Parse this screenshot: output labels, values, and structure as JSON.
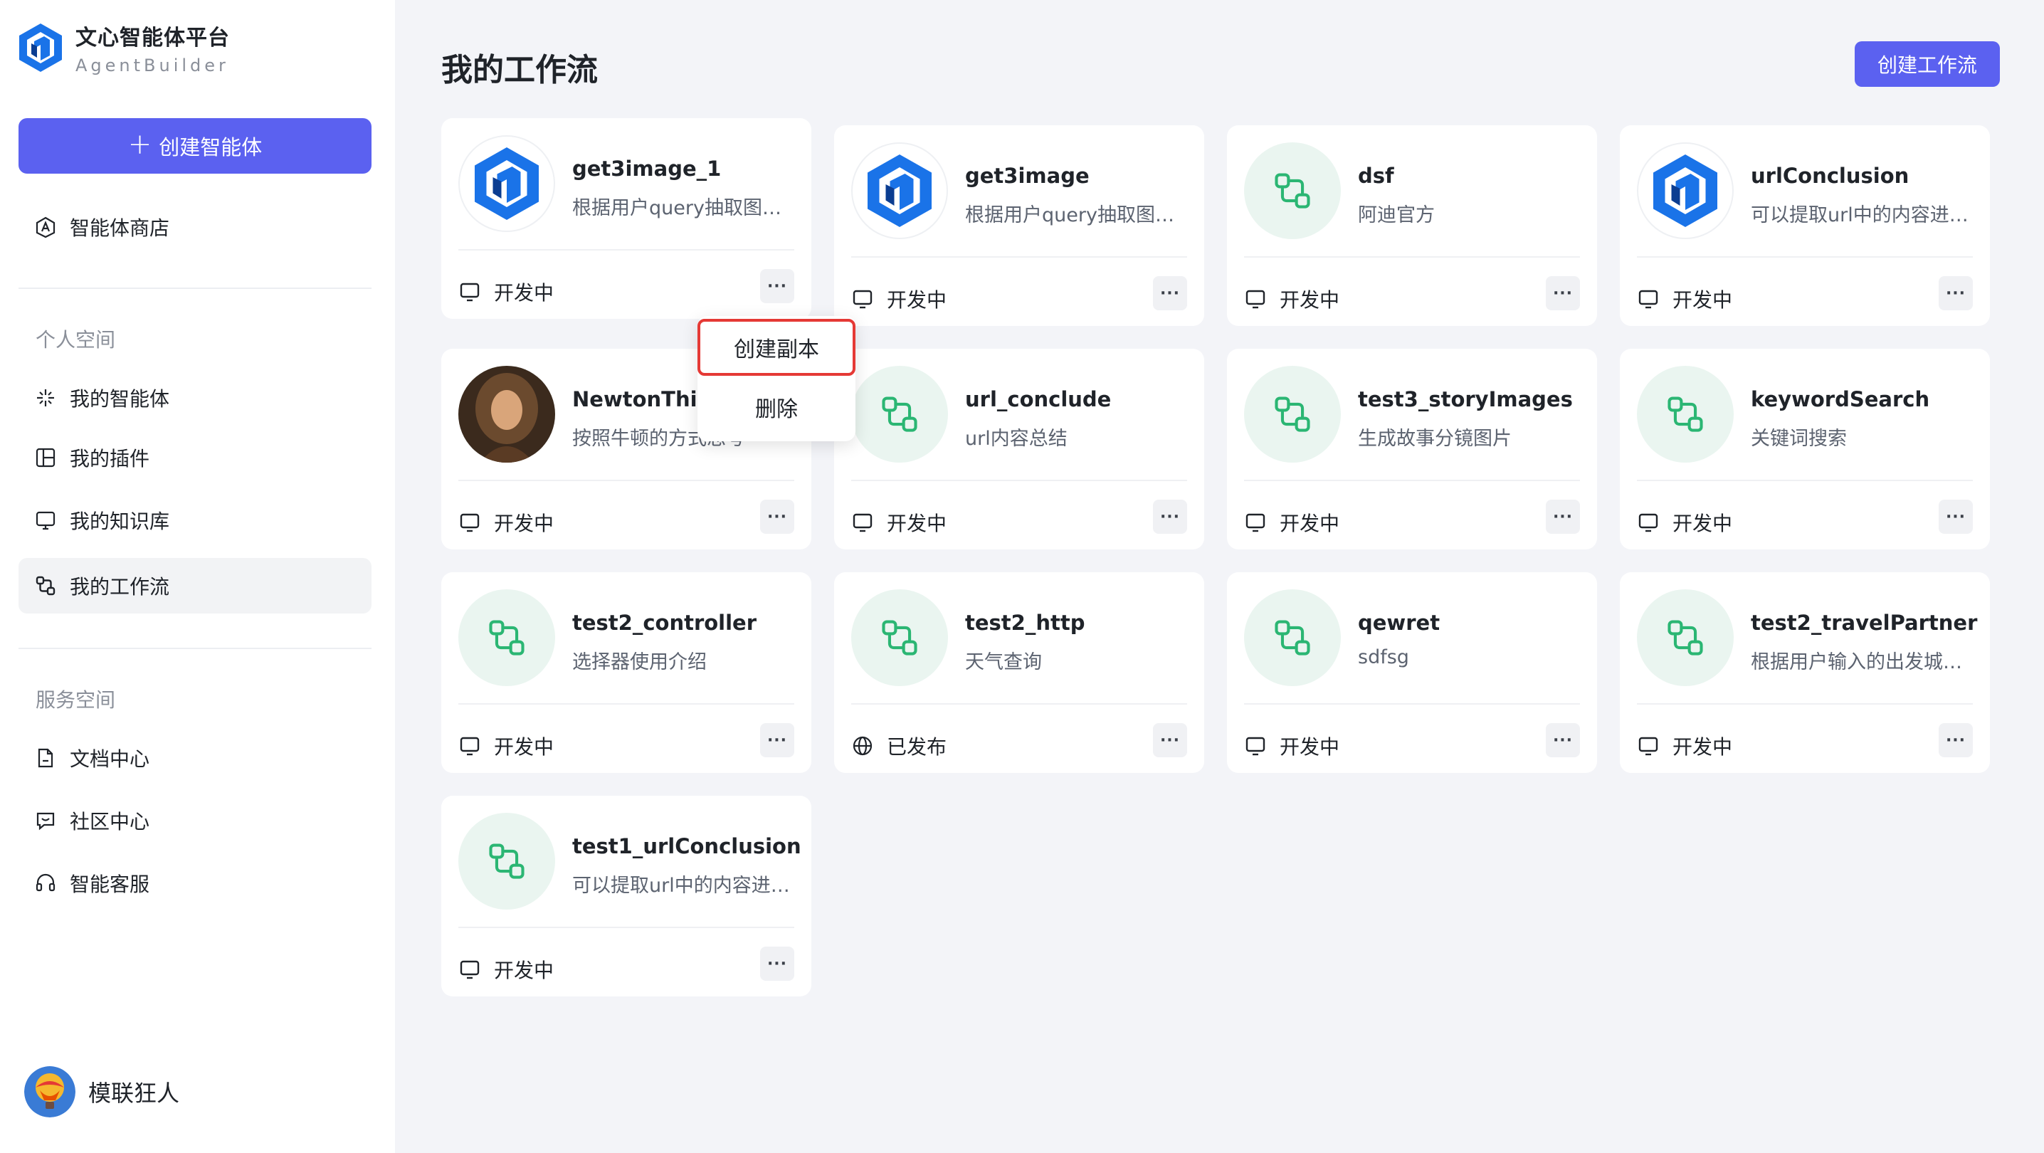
{
  "brand": {
    "title": "文心智能体平台",
    "subtitle": "AgentBuilder",
    "color": "#1a73e8"
  },
  "sidebar": {
    "create_button": "创建智能体",
    "store": "智能体商店",
    "personal_section": "个人空间",
    "personal_items": [
      "我的智能体",
      "我的插件",
      "我的知识库",
      "我的工作流"
    ],
    "service_section": "服务空间",
    "service_items": [
      "文档中心",
      "社区中心",
      "智能客服"
    ],
    "active_item": "我的工作流"
  },
  "user": {
    "name": "模联狂人"
  },
  "header": {
    "title": "我的工作流",
    "create_button": "创建工作流"
  },
  "accent_color": "#5b61f0",
  "cards": [
    {
      "name": "get3image_1",
      "desc": "根据用户query抽取图片的画面",
      "status": "开发中",
      "icon": "logo"
    },
    {
      "name": "get3image",
      "desc": "根据用户query抽取图片的画面",
      "status": "开发中",
      "icon": "logo"
    },
    {
      "name": "dsf",
      "desc": "阿迪官方",
      "status": "开发中",
      "icon": "workflow"
    },
    {
      "name": "urlConclusion",
      "desc": "可以提取url中的内容进行总结",
      "status": "开发中",
      "icon": "logo"
    },
    {
      "name": "NewtonThink",
      "desc": "按照牛顿的方式思考",
      "status": "开发中",
      "icon": "portrait"
    },
    {
      "name": "url_conclude",
      "desc": "url内容总结",
      "status": "开发中",
      "icon": "workflow"
    },
    {
      "name": "test3_storyImages",
      "desc": "生成故事分镜图片",
      "status": "开发中",
      "icon": "workflow"
    },
    {
      "name": "keywordSearch",
      "desc": "关键词搜索",
      "status": "开发中",
      "icon": "workflow"
    },
    {
      "name": "test2_controller",
      "desc": "选择器使用介绍",
      "status": "开发中",
      "icon": "workflow"
    },
    {
      "name": "test2_http",
      "desc": "天气查询",
      "status": "已发布",
      "icon": "workflow"
    },
    {
      "name": "qewret",
      "desc": "sdfsg",
      "status": "开发中",
      "icon": "workflow"
    },
    {
      "name": "test2_travelPartner",
      "desc": "根据用户输入的出发城市推荐",
      "status": "开发中",
      "icon": "workflow"
    },
    {
      "name": "test1_urlConclusion",
      "desc": "可以提取url中的内容进行总结",
      "status": "开发中",
      "icon": "workflow"
    }
  ],
  "more_label": "···",
  "context_menu": {
    "items": [
      "创建副本",
      "删除"
    ],
    "highlight_color": "#e53935"
  }
}
